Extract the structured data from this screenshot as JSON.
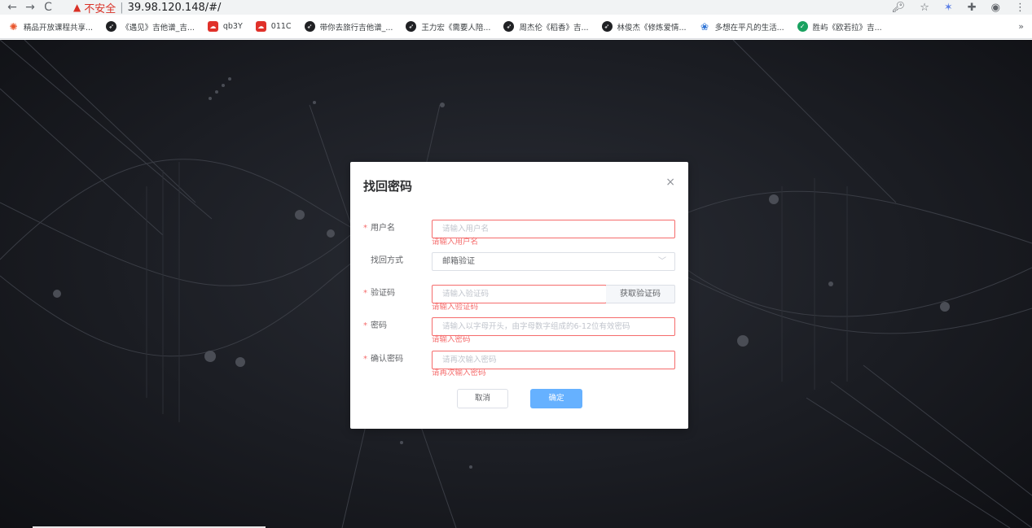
{
  "browser": {
    "back": "←",
    "forward": "→",
    "reload": "C",
    "warning_icon": "▲",
    "insecure_label": "不安全",
    "separator": "|",
    "url": "39.98.120.148/#/",
    "icons": [
      "key-icon",
      "star-icon",
      "extension-icon",
      "puzzle-icon",
      "profile-icon",
      "menu-icon"
    ]
  },
  "bookmarks": [
    {
      "label": "精品开放课程共享...",
      "icon": "star"
    },
    {
      "label": "《遇见》吉他谱_吉...",
      "icon": "dark"
    },
    {
      "label": "qb3Y",
      "icon": "red"
    },
    {
      "label": "011C",
      "icon": "red"
    },
    {
      "label": "带你去旅行吉他谱_...",
      "icon": "dark"
    },
    {
      "label": "王力宏《需要人陪...",
      "icon": "dark"
    },
    {
      "label": "周杰伦《稻香》吉...",
      "icon": "dark"
    },
    {
      "label": "林俊杰《修炼爱情...",
      "icon": "dark"
    },
    {
      "label": "多想在平凡的生活...",
      "icon": "paw"
    },
    {
      "label": "胜屿《欧若拉》吉...",
      "icon": "green"
    }
  ],
  "bookmarks_more": "»",
  "dialog": {
    "title": "找回密码",
    "close": "×",
    "required_mark": "*",
    "username": {
      "label": "用户名",
      "placeholder": "请输入用户名",
      "error": "请输入用户名"
    },
    "method": {
      "label": "找回方式",
      "value": "邮箱验证"
    },
    "code": {
      "label": "验证码",
      "placeholder": "请输入验证码",
      "button": "获取验证码",
      "error": "请输入验证码"
    },
    "password": {
      "label": "密码",
      "placeholder": "请输入以字母开头，由字母数字组成的6-12位有效密码",
      "error": "请输入密码"
    },
    "confirm": {
      "label": "确认密码",
      "placeholder": "请再次输入密码",
      "error": "请再次输入密码"
    },
    "cancel": "取消",
    "ok": "确定"
  },
  "colors": {
    "error": "#f56c6c",
    "primary_light": "#66b1ff",
    "background_dark": "#1b1d23"
  }
}
